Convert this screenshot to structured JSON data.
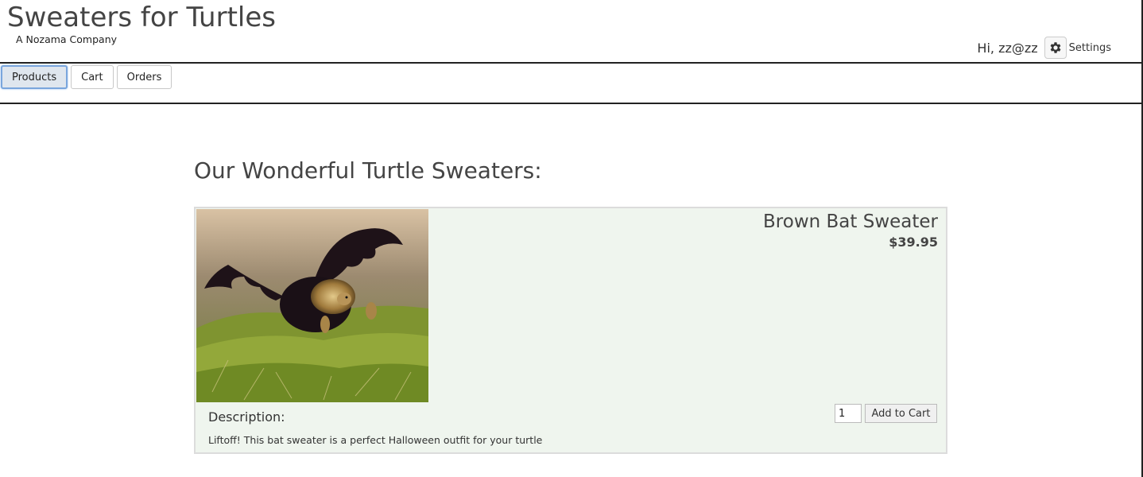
{
  "header": {
    "title": "Sweaters for Turtles",
    "subtitle": "A Nozama Company",
    "greeting": "Hi, zz@zz",
    "settings_label": "Settings",
    "settings_icon": "gear-icon"
  },
  "nav": {
    "items": [
      {
        "label": "Products",
        "active": true
      },
      {
        "label": "Cart",
        "active": false
      },
      {
        "label": "Orders",
        "active": false
      }
    ]
  },
  "main": {
    "heading": "Our Wonderful Turtle Sweaters:",
    "products": [
      {
        "name": "Brown Bat Sweater",
        "price": "$39.95",
        "quantity": "1",
        "add_to_cart_label": "Add to Cart",
        "description_heading": "Description:",
        "description": "Liftoff! This bat sweater is a perfect Halloween outfit for your turtle"
      }
    ]
  },
  "colors": {
    "card_background": "#eff5ee",
    "active_nav_border": "#7aa6dd",
    "text": "#444444"
  }
}
